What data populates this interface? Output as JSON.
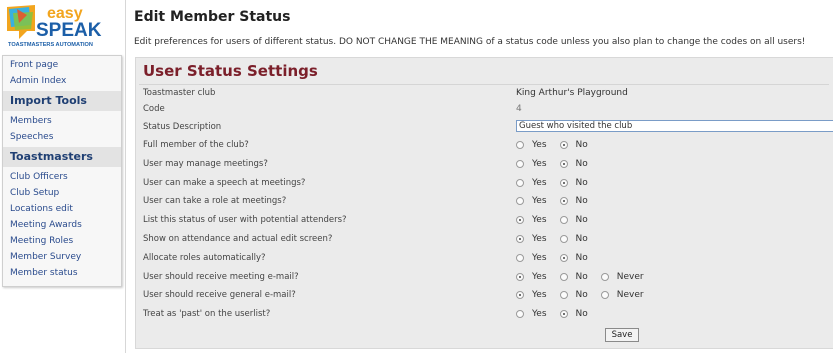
{
  "brand": {
    "logo_top": "easy",
    "logo_main": "SPEAK",
    "logo_sub": "TOASTMASTERS AUTOMATION"
  },
  "sidebar": {
    "links_top": [
      "Front page",
      "Admin Index"
    ],
    "import_heading": "Import Tools",
    "import_links": [
      "Members",
      "Speeches"
    ],
    "tm_heading": "Toastmasters",
    "tm_links": [
      "Club Officers",
      "Club Setup",
      "Locations edit",
      "Meeting Awards",
      "Meeting Roles",
      "Member Survey",
      "Member status"
    ]
  },
  "page": {
    "title": "Edit Member Status",
    "intro": "Edit preferences for users of different status. DO NOT CHANGE THE MEANING of a status code unless you also plan to change the codes on all users!"
  },
  "panel": {
    "title": "User Status Settings",
    "club_label": "Toastmaster club",
    "club_value": "King Arthur's Playground",
    "code_label": "Code",
    "code_value": "4",
    "desc_label": "Status Description",
    "desc_value": "Guest who visited the club",
    "options": {
      "yes": "Yes",
      "no": "No",
      "never": "Never"
    },
    "questions": [
      {
        "label": "Full member of the club?",
        "selected": "no",
        "has_never": false
      },
      {
        "label": "User may manage meetings?",
        "selected": "no",
        "has_never": false
      },
      {
        "label": "User can make a speech at meetings?",
        "selected": "no",
        "has_never": false
      },
      {
        "label": "User can take a role at meetings?",
        "selected": "no",
        "has_never": false
      },
      {
        "label": "List this status of user with potential attenders?",
        "selected": "yes",
        "has_never": false
      },
      {
        "label": "Show on attendance and actual edit screen?",
        "selected": "yes",
        "has_never": false
      },
      {
        "label": "Allocate roles automatically?",
        "selected": "no",
        "has_never": false
      },
      {
        "label": "User should receive meeting e-mail?",
        "selected": "yes",
        "has_never": true
      },
      {
        "label": "User should receive general e-mail?",
        "selected": "yes",
        "has_never": true
      },
      {
        "label": "Treat as 'past' on the userlist?",
        "selected": "no",
        "has_never": false
      }
    ],
    "save_label": "Save"
  },
  "colors": {
    "panel_title": "#7b1f2a",
    "link": "#2a4b8d",
    "logo_blue": "#1c5fa8",
    "logo_orange": "#f2a51e"
  }
}
